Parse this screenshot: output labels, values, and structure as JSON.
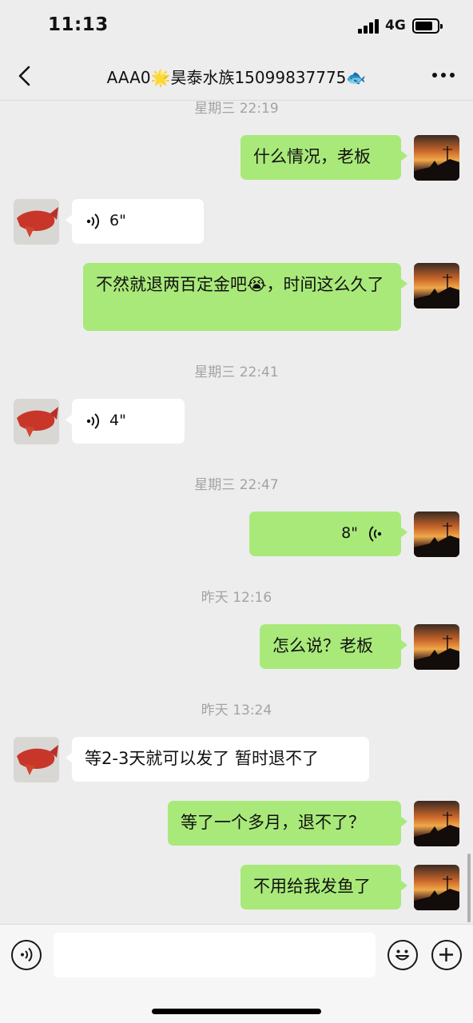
{
  "status_bar": {
    "time": "11:13",
    "network": "4G",
    "battery_level": 0.7
  },
  "header": {
    "title": "AAA0🌟昊泰水族15099837775🐟"
  },
  "messages": [
    {
      "kind": "timestamp",
      "text": "星期三 22:19"
    },
    {
      "kind": "text",
      "sender": "me",
      "text": "什么情况，老板"
    },
    {
      "kind": "voice",
      "sender": "other",
      "duration": "6\""
    },
    {
      "kind": "text",
      "sender": "me",
      "text": "不然就退两百定金吧😭，时间这么久了"
    },
    {
      "kind": "timestamp",
      "text": "星期三 22:41"
    },
    {
      "kind": "voice",
      "sender": "other",
      "duration": "4\""
    },
    {
      "kind": "timestamp",
      "text": "星期三 22:47"
    },
    {
      "kind": "voice",
      "sender": "me",
      "duration": "8\""
    },
    {
      "kind": "timestamp",
      "text": "昨天 12:16"
    },
    {
      "kind": "text",
      "sender": "me",
      "text": "怎么说？老板"
    },
    {
      "kind": "timestamp",
      "text": "昨天 13:24"
    },
    {
      "kind": "text",
      "sender": "other",
      "text": "等2-3天就可以发了 暂时退不了"
    },
    {
      "kind": "text",
      "sender": "me",
      "text": "等了一个多月，退不了？"
    },
    {
      "kind": "text",
      "sender": "me",
      "text": "不用给我发鱼了"
    }
  ],
  "input_bar": {
    "placeholder": "",
    "icons": [
      "voice-mode-icon",
      "emoji-icon",
      "plus-icon"
    ]
  },
  "colors": {
    "my_bubble": "#a9e97a",
    "other_bubble": "#ffffff",
    "background": "#ededed",
    "timestamp": "#a3a3a3"
  }
}
